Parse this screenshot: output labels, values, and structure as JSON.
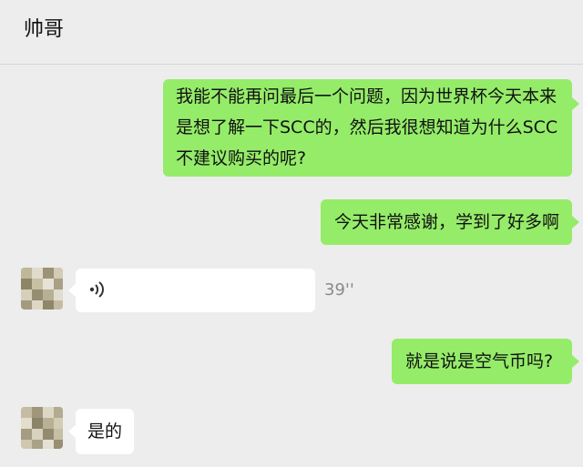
{
  "header": {
    "title": "帅哥"
  },
  "messages": [
    {
      "side": "out",
      "lines": [
        "我能不能再问最后一个问题，因为世界杯今天本来",
        "是想了解一下SCC的，然后我很想知道为什么SCC",
        "不建议购买的呢?"
      ]
    },
    {
      "side": "out",
      "text": "今天非常感谢，学到了好多啊"
    },
    {
      "side": "in",
      "type": "voice",
      "icon": "voice-wave-icon",
      "duration": "39''"
    },
    {
      "side": "out",
      "text": "就是说是空气币吗?"
    },
    {
      "side": "in",
      "text": "是的"
    }
  ],
  "colors": {
    "outgoing_bubble": "#95ec69",
    "incoming_bubble": "#ffffff",
    "background": "#ededed"
  }
}
